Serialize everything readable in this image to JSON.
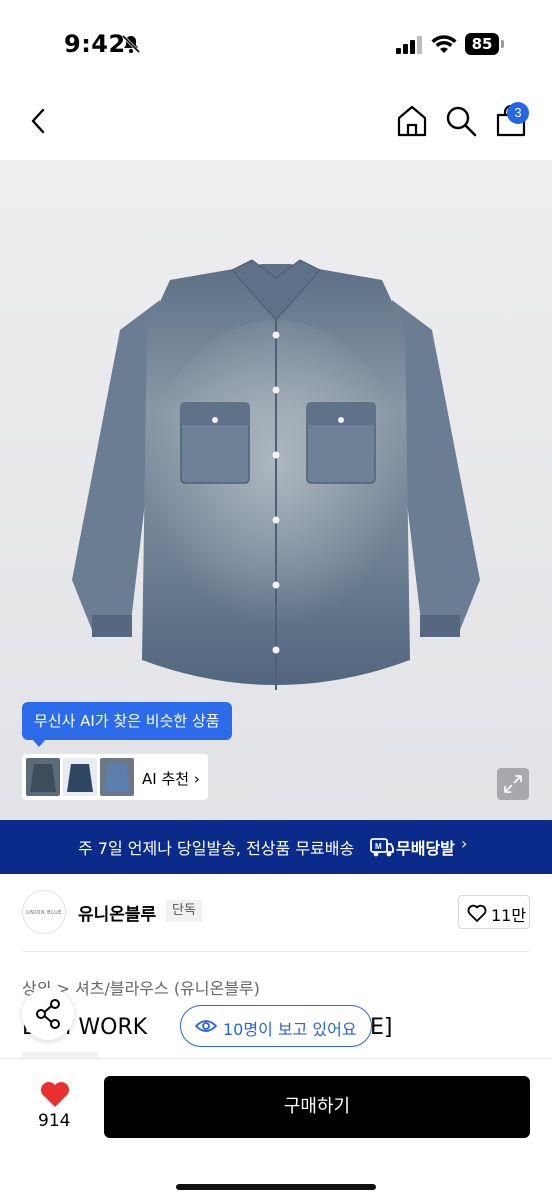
{
  "status_bar": {
    "time": "9:42",
    "battery": "85"
  },
  "nav": {
    "cart_count": "3"
  },
  "hero": {
    "ai_tooltip": "무신사 AI가 찾은 비슷한 상품",
    "ai_label": "AI 추천"
  },
  "promo": {
    "text": "주 7일 언제나 당일발송, 전상품 무료배송",
    "brand": "무배당발"
  },
  "brand": {
    "logo_text": "UNION BLUE",
    "name": "유니온블루",
    "exclusive": "단독",
    "likes": "11만"
  },
  "product": {
    "breadcrumb": "상의 > 셔츠/블라우스 (유니온블루)",
    "title_visible": "D  IM WORK",
    "title_tail": "E]",
    "viewers": "10명이 보고 있어요"
  },
  "bottom": {
    "heart_count": "914",
    "buy_label": "구매하기"
  },
  "colors": {
    "accent": "#2a63e0",
    "promo_bg": "#0a2b8a",
    "heart": "#e8302f"
  }
}
